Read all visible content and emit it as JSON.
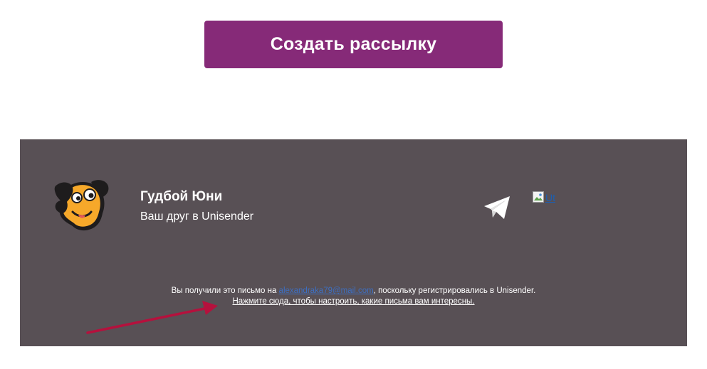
{
  "cta": {
    "label": "Создать рассылку",
    "color": "#862a78"
  },
  "footer": {
    "background": "#585055",
    "mascot_icon": "dog-mascot-icon",
    "sender_name": "Гудбой Юни",
    "sender_tagline": "Ваш друг в Unisender",
    "social": {
      "telegram_icon": "telegram-icon",
      "broken_image_alt": "Ut"
    },
    "notice": {
      "prefix": "Вы получили это письмо на ",
      "email": "alexandraka79@mail.com",
      "suffix": ", поскольку регистрировались в Unisender.",
      "settings_link": "Нажмите сюда, чтобы настроить, какие письма вам интересны."
    }
  },
  "annotation": {
    "arrow_icon": "red-arrow-icon",
    "color": "#b5113d"
  }
}
